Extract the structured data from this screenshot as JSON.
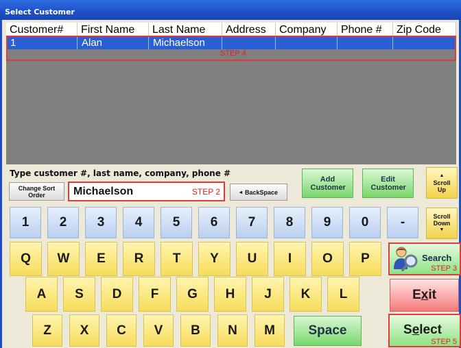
{
  "window": {
    "title": "Select Customer"
  },
  "grid": {
    "columns": [
      "Customer#",
      "First Name",
      "Last Name",
      "Address",
      "Company",
      "Phone #",
      "Zip Code"
    ],
    "rows": [
      [
        "1",
        "Alan",
        "Michaelson",
        "",
        "",
        "",
        ""
      ]
    ],
    "step_label": "STEP 4"
  },
  "search": {
    "prompt": "Type customer #, last name, company, phone #",
    "value": "Michaelson",
    "step_label": "STEP 2"
  },
  "buttons": {
    "change_sort": "Change Sort Order",
    "backspace": "BackSpace",
    "add_customer": "Add Customer",
    "edit_customer": "Edit Customer",
    "scroll_up": "Scroll Up",
    "scroll_down": "Scroll Down",
    "search": "Search",
    "search_step": "STEP 3",
    "exit": "Exit",
    "select": "Select",
    "select_step": "STEP 5",
    "space": "Space"
  },
  "keypad": {
    "numbers": [
      "1",
      "2",
      "3",
      "4",
      "5",
      "6",
      "7",
      "8",
      "9",
      "0",
      "-"
    ],
    "row1": [
      "Q",
      "W",
      "E",
      "R",
      "T",
      "Y",
      "U",
      "I",
      "O",
      "P"
    ],
    "row2": [
      "A",
      "S",
      "D",
      "F",
      "G",
      "H",
      "J",
      "K",
      "L"
    ],
    "row3": [
      "Z",
      "X",
      "C",
      "V",
      "B",
      "N",
      "M"
    ]
  }
}
